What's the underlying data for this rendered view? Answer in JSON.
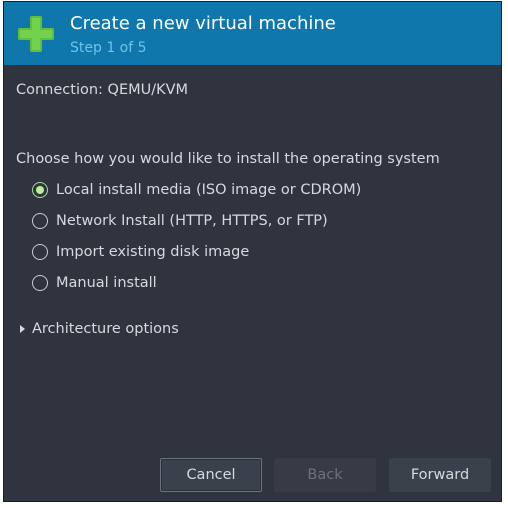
{
  "header": {
    "title": "Create a new virtual machine",
    "subtitle": "Step 1 of 5",
    "icon": "green-plus-icon",
    "background_color": "#0f77ab"
  },
  "connection": {
    "text": "Connection: QEMU/KVM"
  },
  "install_method": {
    "prompt": "Choose how you would like to install the operating system",
    "options": [
      {
        "label": "Local install media (ISO image or CDROM)",
        "selected": true
      },
      {
        "label": "Network Install (HTTP, HTTPS, or FTP)",
        "selected": false
      },
      {
        "label": "Import existing disk image",
        "selected": false
      },
      {
        "label": "Manual install",
        "selected": false
      }
    ]
  },
  "architecture": {
    "label": "Architecture options",
    "expanded": false
  },
  "buttons": {
    "cancel": "Cancel",
    "back": "Back",
    "forward": "Forward",
    "back_enabled": false
  }
}
